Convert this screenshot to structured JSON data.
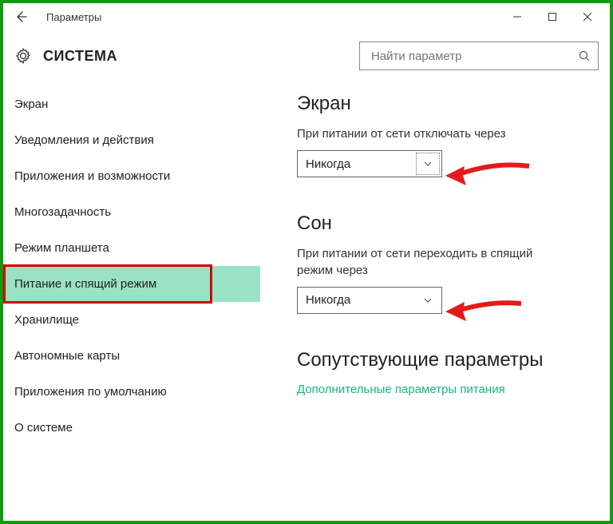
{
  "window": {
    "title": "Параметры"
  },
  "header": {
    "title": "СИСТЕМА",
    "search_placeholder": "Найти параметр"
  },
  "sidebar": {
    "items": [
      {
        "label": "Экран"
      },
      {
        "label": "Уведомления и действия"
      },
      {
        "label": "Приложения и возможности"
      },
      {
        "label": "Многозадачность"
      },
      {
        "label": "Режим планшета"
      },
      {
        "label": "Питание и спящий режим",
        "selected": true
      },
      {
        "label": "Хранилище"
      },
      {
        "label": "Автономные карты"
      },
      {
        "label": "Приложения по умолчанию"
      },
      {
        "label": "О системе"
      }
    ]
  },
  "content": {
    "screen": {
      "heading": "Экран",
      "label": "При питании от сети отключать через",
      "value": "Никогда"
    },
    "sleep": {
      "heading": "Сон",
      "label": "При питании от сети переходить в спящий режим через",
      "value": "Никогда"
    },
    "related": {
      "heading": "Сопутствующие параметры",
      "link": "Дополнительные параметры питания"
    }
  },
  "colors": {
    "accent_link": "#1cb48c",
    "selection_bg": "#99e2c4",
    "highlight_border": "#d40000",
    "arrow": "#e51a1a",
    "frame": "#0f9b0f"
  }
}
